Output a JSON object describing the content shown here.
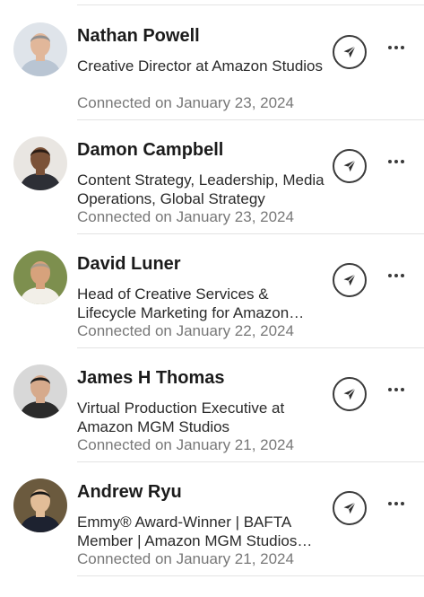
{
  "connections": [
    {
      "name": "Nathan Powell",
      "headline": "Creative Director at Amazon Studios",
      "connected": "Connected on January 23, 2024",
      "avatar_colors": {
        "bg": "#dfe4ea",
        "skin": "#e1b79a",
        "hair": "#8f8f8f",
        "shirt": "#b9c5d3"
      }
    },
    {
      "name": "Damon Campbell",
      "headline": "Content Strategy, Leadership, Media Operations, Global Strategy",
      "connected": "Connected on January 23, 2024",
      "avatar_colors": {
        "bg": "#e9e6e2",
        "skin": "#7b5238",
        "hair": "#2a1c14",
        "shirt": "#2d2f36"
      }
    },
    {
      "name": "David Luner",
      "headline": "Head of Creative Services & Lifecycle Marketing for Amazon Studios",
      "connected": "Connected on January 22, 2024",
      "avatar_colors": {
        "bg": "#7d8f4e",
        "skin": "#d7a27c",
        "hair": "#a89c8c",
        "shirt": "#f2efe8"
      }
    },
    {
      "name": "James H Thomas",
      "headline": "Virtual Production Executive at Amazon MGM Studios",
      "connected": "Connected on January 21, 2024",
      "avatar_colors": {
        "bg": "#d8d8d8",
        "skin": "#d6aa8c",
        "hair": "#1c1c1c",
        "shirt": "#2b2b2b"
      }
    },
    {
      "name": "Andrew Ryu",
      "headline": "Emmy® Award-Winner | BAFTA Member | Amazon MGM Studios Executive",
      "connected": "Connected on January 21, 2024",
      "avatar_colors": {
        "bg": "#6b5a3e",
        "skin": "#e2bd98",
        "hair": "#161616",
        "shirt": "#1d2230"
      }
    }
  ],
  "icons": {
    "message": "paper-plane-icon",
    "more": "ellipsis-icon"
  }
}
